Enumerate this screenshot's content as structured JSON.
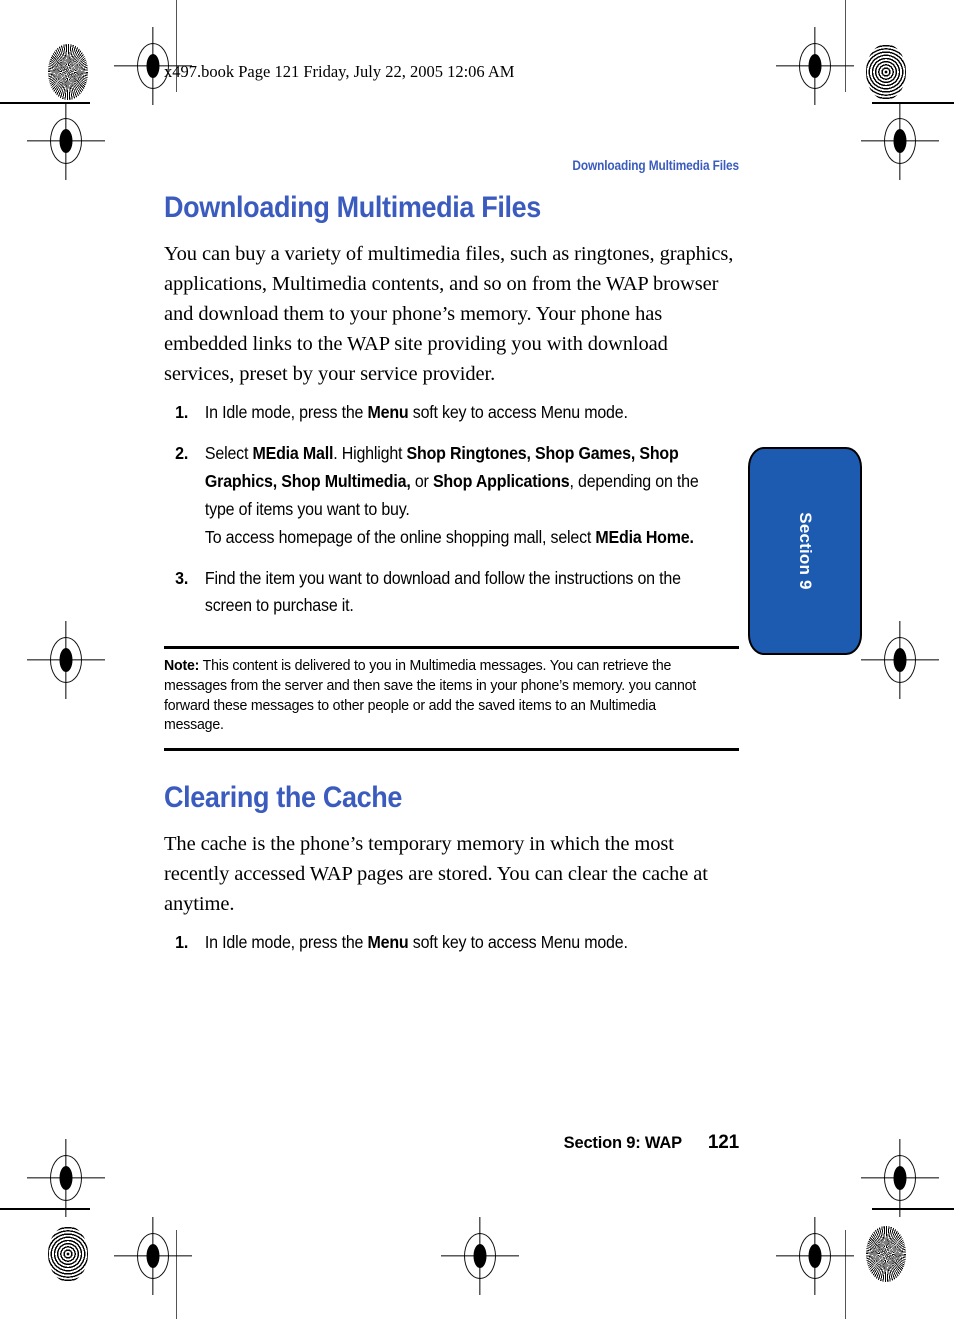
{
  "slug": "x497.book  Page 121  Friday, July 22, 2005  12:06 AM",
  "running_head": "Downloading Multimedia Files",
  "colors": {
    "heading_blue": "#3b5cbe",
    "tab_blue": "#1d5bb0",
    "text_black": "#000000",
    "page_background": "#ffffff"
  },
  "sections": [
    {
      "title": "Downloading Multimedia Files",
      "paragraph": "You can buy a variety of multimedia files, such as ringtones, graphics, applications, Multimedia contents, and so on from the WAP browser and download them to your phone’s memory. Your phone has embedded links to the WAP site providing you with download services, preset by your service provider.",
      "steps": [
        {
          "num": "1.",
          "parts": [
            {
              "text": "In Idle mode, press the ",
              "bold": false
            },
            {
              "text": "Menu",
              "bold": true
            },
            {
              "text": " soft key to access Menu mode.",
              "bold": false
            }
          ]
        },
        {
          "num": "2.",
          "parts": [
            {
              "text": "Select ",
              "bold": false
            },
            {
              "text": "MEdia Mall",
              "bold": true
            },
            {
              "text": ". Highlight ",
              "bold": false
            },
            {
              "text": "Shop Ringtones, Shop Games, Shop Graphics, Shop Multimedia,",
              "bold": true
            },
            {
              "text": " or ",
              "bold": false
            },
            {
              "text": "Shop Applications",
              "bold": true
            },
            {
              "text": ", depending on the type of items you want to buy.",
              "bold": false
            }
          ],
          "extra_parts": [
            {
              "text": "To access homepage of the online shopping mall, select ",
              "bold": false
            },
            {
              "text": "MEdia Home.",
              "bold": true
            }
          ]
        },
        {
          "num": "3.",
          "parts": [
            {
              "text": "Find the item you want to download and follow the instructions on the screen to purchase it.",
              "bold": false
            }
          ]
        }
      ]
    },
    {
      "title": "Clearing the Cache",
      "paragraph": "The cache is the phone’s temporary memory in which the most recently accessed WAP pages are stored. You can clear the cache at anytime.",
      "steps": [
        {
          "num": "1.",
          "parts": [
            {
              "text": "In Idle mode, press the ",
              "bold": false
            },
            {
              "text": "Menu",
              "bold": true
            },
            {
              "text": " soft key to access Menu mode.",
              "bold": false
            }
          ]
        }
      ]
    }
  ],
  "note": {
    "label": "Note:",
    "text": " This content is delivered to you in Multimedia messages. You can retrieve the messages from the server and then save the items in your phone’s memory. you cannot forward these messages to other people or add the saved items to an Multimedia message."
  },
  "side_tab": {
    "label": "Section 9"
  },
  "footer": {
    "section_label": "Section 9: WAP",
    "page_number": "121"
  }
}
